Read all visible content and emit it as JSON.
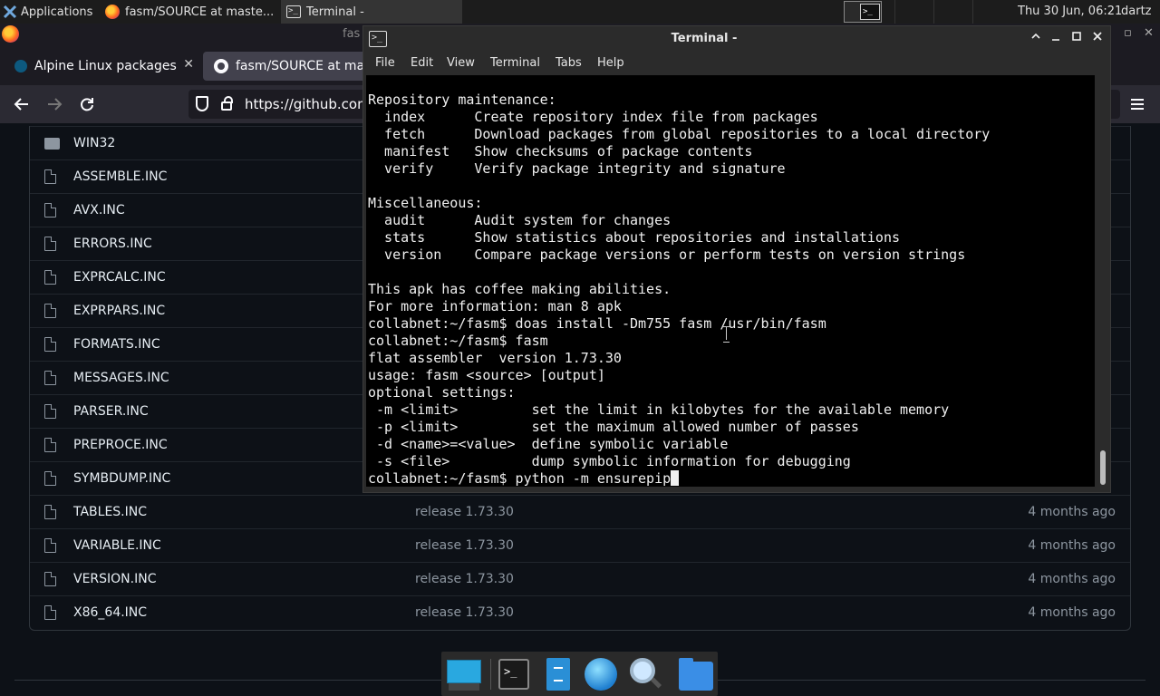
{
  "top_panel": {
    "applications_label": "Applications",
    "tasks": [
      {
        "label": "fasm/SOURCE at maste..."
      },
      {
        "label": "Terminal -"
      }
    ],
    "clock": "Thu 30 Jun, 06:21",
    "user": "dartz"
  },
  "browser": {
    "window_title": "fas",
    "tabs": [
      {
        "label": "Alpine Linux packages"
      },
      {
        "label": "fasm/SOURCE at mast"
      }
    ],
    "url": "https://github.com",
    "files": [
      {
        "name": "WIN32",
        "type": "folder",
        "message": "",
        "age": ""
      },
      {
        "name": "ASSEMBLE.INC",
        "type": "file",
        "message": "",
        "age": ""
      },
      {
        "name": "AVX.INC",
        "type": "file",
        "message": "",
        "age": ""
      },
      {
        "name": "ERRORS.INC",
        "type": "file",
        "message": "",
        "age": ""
      },
      {
        "name": "EXPRCALC.INC",
        "type": "file",
        "message": "",
        "age": ""
      },
      {
        "name": "EXPRPARS.INC",
        "type": "file",
        "message": "",
        "age": ""
      },
      {
        "name": "FORMATS.INC",
        "type": "file",
        "message": "",
        "age": ""
      },
      {
        "name": "MESSAGES.INC",
        "type": "file",
        "message": "",
        "age": ""
      },
      {
        "name": "PARSER.INC",
        "type": "file",
        "message": "",
        "age": ""
      },
      {
        "name": "PREPROCE.INC",
        "type": "file",
        "message": "",
        "age": ""
      },
      {
        "name": "SYMBDUMP.INC",
        "type": "file",
        "message": "",
        "age": ""
      },
      {
        "name": "TABLES.INC",
        "type": "file",
        "message": "release 1.73.30",
        "age": "4 months ago"
      },
      {
        "name": "VARIABLE.INC",
        "type": "file",
        "message": "release 1.73.30",
        "age": "4 months ago"
      },
      {
        "name": "VERSION.INC",
        "type": "file",
        "message": "release 1.73.30",
        "age": "4 months ago"
      },
      {
        "name": "X86_64.INC",
        "type": "file",
        "message": "release 1.73.30",
        "age": "4 months ago"
      }
    ]
  },
  "terminal": {
    "title": "Terminal -",
    "menu": [
      "File",
      "Edit",
      "View",
      "Terminal",
      "Tabs",
      "Help"
    ],
    "lines": [
      "Repository maintenance:",
      "  index      Create repository index file from packages",
      "  fetch      Download packages from global repositories to a local directory",
      "  manifest   Show checksums of package contents",
      "  verify     Verify package integrity and signature",
      "",
      "Miscellaneous:",
      "  audit      Audit system for changes",
      "  stats      Show statistics about repositories and installations",
      "  version    Compare package versions or perform tests on version strings",
      "",
      "This apk has coffee making abilities.",
      "For more information: man 8 apk",
      "collabnet:~/fasm$ doas install -Dm755 fasm /usr/bin/fasm",
      "collabnet:~/fasm$ fasm",
      "flat assembler  version 1.73.30",
      "usage: fasm <source> [output]",
      "optional settings:",
      " -m <limit>         set the limit in kilobytes for the available memory",
      " -p <limit>         set the maximum allowed number of passes",
      " -d <name>=<value>  define symbolic variable",
      " -s <file>          dump symbolic information for debugging"
    ],
    "prompt_line": "collabnet:~/fasm$ python -m ensurepip"
  },
  "dock": {
    "items": [
      {
        "icon": "desktop-icon"
      },
      {
        "icon": "terminal-icon"
      },
      {
        "icon": "file-manager-icon"
      },
      {
        "icon": "web-browser-icon"
      },
      {
        "icon": "search-icon"
      },
      {
        "icon": "folder-icon"
      }
    ]
  }
}
